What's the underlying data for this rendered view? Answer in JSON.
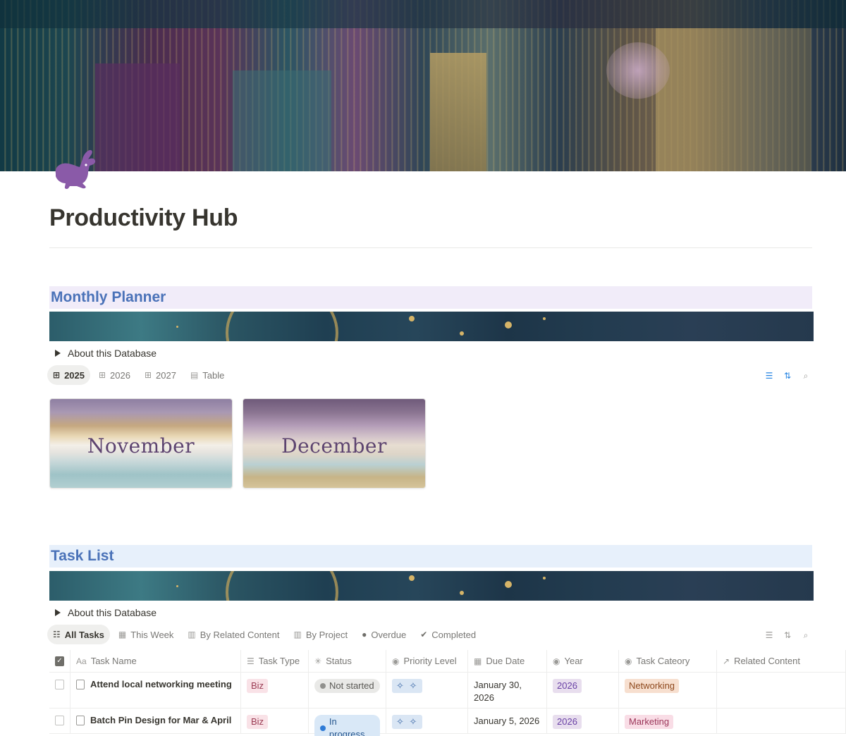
{
  "page": {
    "title": "Productivity Hub",
    "icon": "rabbit-icon"
  },
  "monthly_planner": {
    "heading": "Monthly Planner",
    "toggle_label": "About this Database",
    "tabs": [
      {
        "label": "2025",
        "icon": "gallery-icon",
        "active": true
      },
      {
        "label": "2026",
        "icon": "gallery-icon",
        "active": false
      },
      {
        "label": "2027",
        "icon": "gallery-icon",
        "active": false
      },
      {
        "label": "Table",
        "icon": "table-icon",
        "active": false
      }
    ],
    "cards": [
      {
        "label": "November"
      },
      {
        "label": "December"
      }
    ]
  },
  "task_list": {
    "heading": "Task List",
    "toggle_label": "About this Database",
    "tabs": [
      {
        "label": "All Tasks",
        "icon": "checklist-icon",
        "active": true
      },
      {
        "label": "This Week",
        "icon": "calendar-icon",
        "active": false
      },
      {
        "label": "By Related Content",
        "icon": "board-icon",
        "active": false
      },
      {
        "label": "By Project",
        "icon": "board-icon",
        "active": false
      },
      {
        "label": "Overdue",
        "icon": "alert-icon",
        "active": false
      },
      {
        "label": "Completed",
        "icon": "check-circle-icon",
        "active": false
      }
    ],
    "columns": [
      "Task Name",
      "Task Type",
      "Status",
      "Priority Level",
      "Due Date",
      "Year",
      "Task Cateory",
      "Related Content"
    ],
    "column_icons": [
      "Aa",
      "list-icon",
      "spinner-icon",
      "select-icon",
      "calendar-icon",
      "select-icon",
      "select-icon",
      "arrow-up-right-icon"
    ],
    "rows": [
      {
        "name": "Attend local networking meeting",
        "type": "Biz",
        "status": "Not started",
        "priority": "✧ ✧",
        "due_line1": "January 30,",
        "due_line2": "2026",
        "year": "2026",
        "category": "Networking",
        "related": ""
      },
      {
        "name": "Batch Pin Design for Mar & April",
        "type": "Biz",
        "status": "In progress",
        "priority": "✧ ✧",
        "due_line1": "January 5, 2026",
        "due_line2": "",
        "year": "2026",
        "category": "Marketing",
        "related": ""
      }
    ]
  },
  "colors": {
    "heading_blue": "#4a72b8",
    "planner_heading_bg": "#f1ecf9",
    "task_heading_bg": "#e7f0fb",
    "accent_blue": "#2383e2"
  }
}
